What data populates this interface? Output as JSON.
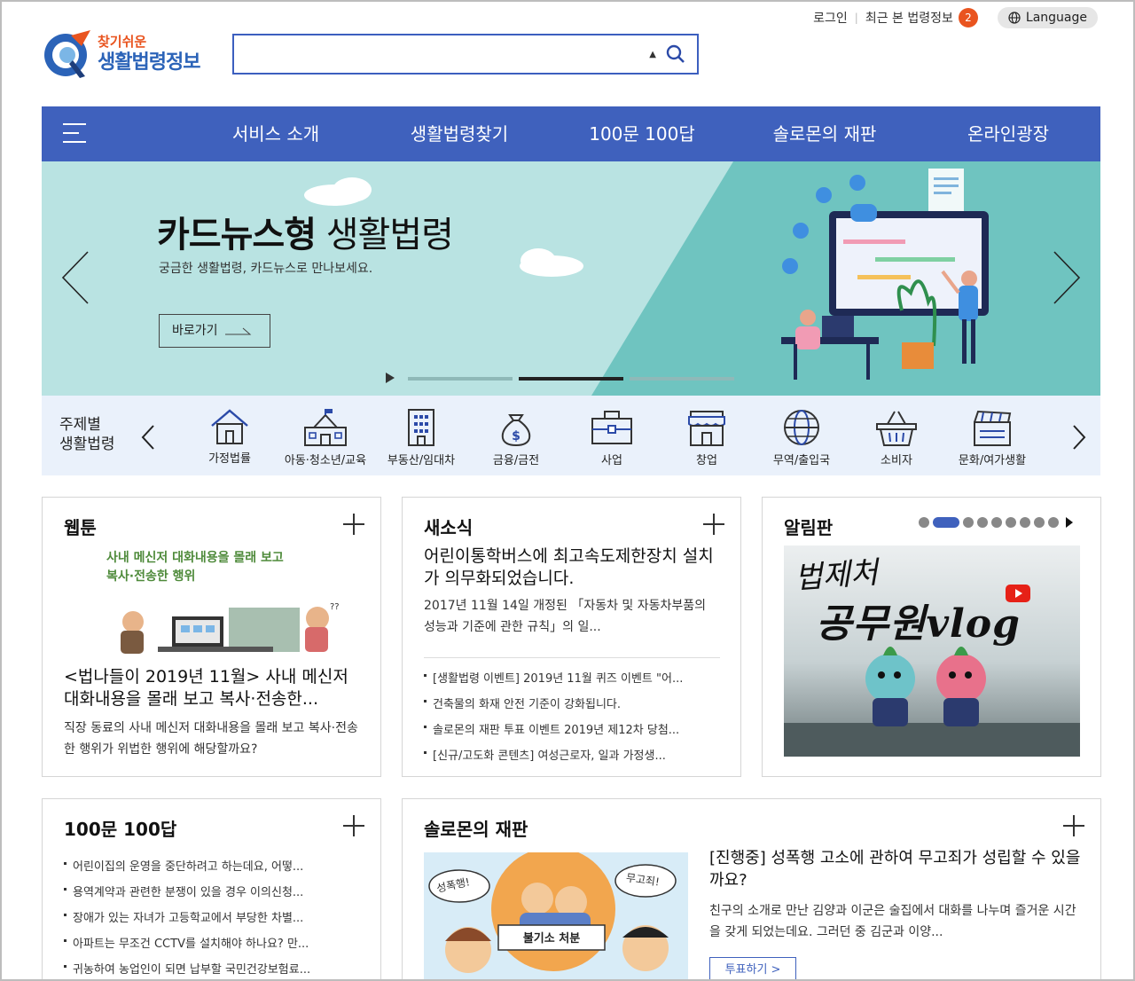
{
  "header": {
    "login": "로그인",
    "recent": "최근 본 법령정보",
    "recent_count": "2",
    "language": "Language",
    "logo_top": "찾기쉬운",
    "logo_main": "생활법령정보",
    "search_placeholder": ""
  },
  "nav": {
    "items": [
      "서비스 소개",
      "생활법령찾기",
      "100문 100답",
      "솔로몬의 재판",
      "온라인광장"
    ]
  },
  "banner": {
    "title_bold": "카드뉴스형",
    "title_rest": "생활법령",
    "subtitle": "궁금한 생활법령, 카드뉴스로 만나보세요.",
    "button": "바로가기"
  },
  "categories": {
    "title_line1": "주제별",
    "title_line2": "생활법령",
    "items": [
      "가정법률",
      "아동·청소년/교육",
      "부동산/임대차",
      "금융/금전",
      "사업",
      "창업",
      "무역/출입국",
      "소비자",
      "문화/여가생활"
    ]
  },
  "webtoon": {
    "title": "웹툰",
    "image_caption_1": "사내 메신저 대화내용을 몰래 보고",
    "image_caption_2": "복사·전송한 행위",
    "headline": "<법나들이 2019년 11월> 사내 메신저 대화내용을 몰래 보고 복사·전송한...",
    "desc": "직장 동료의 사내 메신저 대화내용을 몰래 보고 복사·전송한 행위가 위법한 행위에 해당할까요?"
  },
  "news": {
    "title": "새소식",
    "headline": "어린이통학버스에 최고속도제한장치 설치가 의무화되었습니다.",
    "summary": "2017년 11월 14일 개정된 「자동차 및 자동차부품의 성능과 기준에 관한 규칙」의 일...",
    "items": [
      "[생활법령 이벤트] 2019년 11월 퀴즈 이벤트 \"어...",
      "건축물의 화재 안전 기준이 강화됩니다.",
      "솔로몬의 재판 투표 이벤트 2019년 제12차 당첨...",
      "[신규/고도화 콘텐츠] 여성근로자, 일과 가정생..."
    ]
  },
  "notice": {
    "title": "알림판",
    "image_text_1": "법제처",
    "image_text_2": "공무원vlog"
  },
  "qa": {
    "title": "100문 100답",
    "items": [
      "어린이집의 운영을 중단하려고 하는데요, 어떻...",
      "용역계약과 관련한 분쟁이 있을 경우 이의신청...",
      "장애가 있는 자녀가 고등학교에서 부당한 차별...",
      "아파트는 무조건 CCTV를 설치해야 하나요? 만...",
      "귀농하여 농업인이 되면 납부할 국민건강보험료..."
    ]
  },
  "solomon": {
    "title": "솔로몬의 재판",
    "headline": "[진행중] 성폭행 고소에 관하여 무고죄가 성립할 수 있을까요?",
    "summary": "친구의 소개로 만난 김양과 이군은 술집에서 대화를 나누며 즐거운 시간을 갖게 되었는데요. 그러던 중 김군과 이양...",
    "vote": "투표하기 >",
    "bubble_left": "성폭행!",
    "bubble_right": "무고죄!",
    "stamp": "불기소 처분"
  },
  "colors": {
    "primary": "#3f61bd",
    "accent": "#e9541f",
    "banner_bg": "#b9e3e2",
    "category_bg": "#eaf1fb"
  }
}
